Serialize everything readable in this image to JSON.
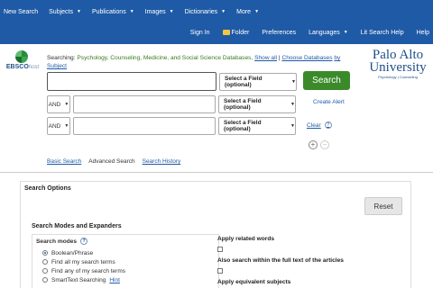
{
  "top_nav": {
    "items": [
      {
        "label": "New Search",
        "has_caret": false
      },
      {
        "label": "Subjects",
        "has_caret": true
      },
      {
        "label": "Publications",
        "has_caret": true
      },
      {
        "label": "Images",
        "has_caret": true
      },
      {
        "label": "Dictionaries",
        "has_caret": true
      },
      {
        "label": "More",
        "has_caret": true
      }
    ]
  },
  "secondary_nav": {
    "sign_in": "Sign In",
    "folder": "Folder",
    "preferences": "Preferences",
    "languages": "Languages",
    "lit_search_help": "Lit Search Help",
    "help": "Help"
  },
  "ebsco_logo": {
    "main": "EBSCO",
    "suffix": "host"
  },
  "searching": {
    "prefix": "Searching:",
    "databases": "Psychology, Counseling, Medicine, and Social Science Databases,",
    "show_all": "Show all",
    "separator": "|",
    "choose_databases": "Choose Databases",
    "by_subject": "by Subject"
  },
  "search_rows": [
    {
      "boolean": "",
      "value": "",
      "field": "Select a Field (optional)"
    },
    {
      "boolean": "AND",
      "value": "",
      "field": "Select a Field (optional)"
    },
    {
      "boolean": "AND",
      "value": "",
      "field": "Select a Field (optional)"
    }
  ],
  "search_button": "Search",
  "create_alert": "Create Alert",
  "clear": "Clear",
  "help_glyph": "?",
  "plus_glyph": "+",
  "minus_glyph": "−",
  "search_links": {
    "basic": "Basic Search",
    "advanced": "Advanced Search",
    "history": "Search History"
  },
  "pau_logo": {
    "line1": "Palo Alto",
    "line2": "University",
    "tagline": "Psychology | Counseling"
  },
  "search_options": {
    "title": "Search Options",
    "reset": "Reset",
    "modes_title": "Search Modes and Expanders",
    "modes_label": "Search modes",
    "modes": [
      {
        "label": "Boolean/Phrase",
        "selected": true
      },
      {
        "label": "Find all my search terms",
        "selected": false
      },
      {
        "label": "Find any of my search terms",
        "selected": false
      },
      {
        "label": "SmartText Searching",
        "selected": false,
        "hint": "Hint"
      }
    ],
    "expanders": [
      {
        "label": "Apply related words",
        "checked": false
      },
      {
        "label": "Also search within the full text of the articles",
        "checked": false
      },
      {
        "label": "Apply equivalent subjects",
        "checked": false
      }
    ]
  },
  "colors": {
    "accent": "#1f5aa6",
    "search_button": "#3a8a2a",
    "database_text": "#3a7a1f"
  }
}
